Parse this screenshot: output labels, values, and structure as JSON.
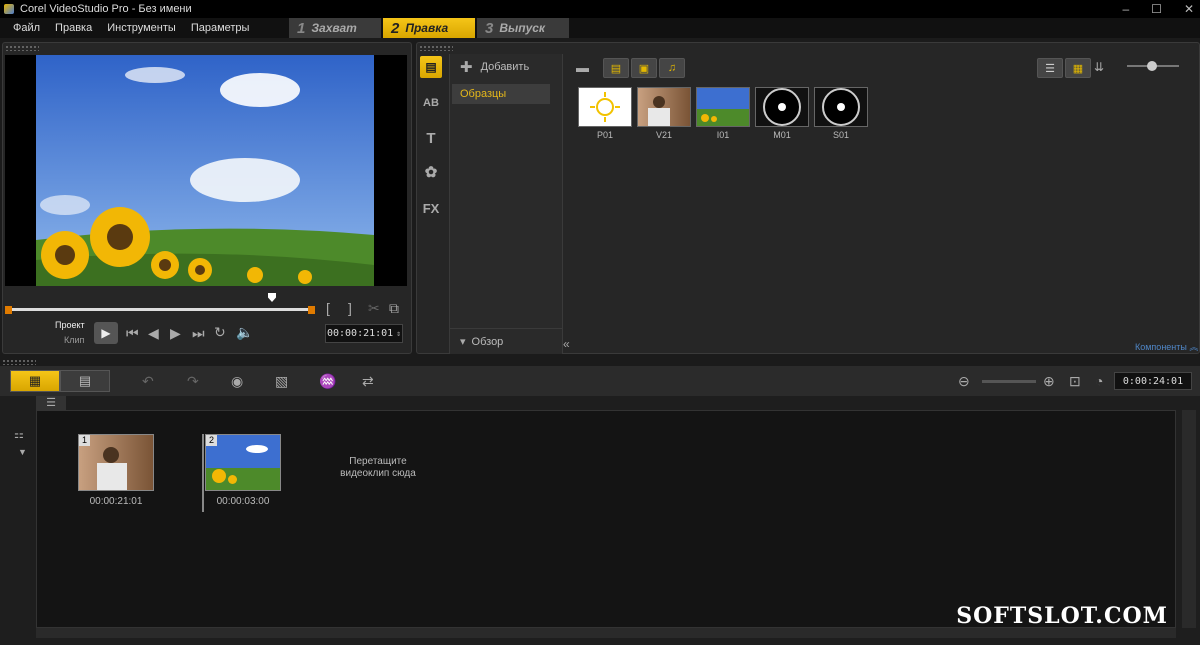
{
  "window": {
    "title": "Corel VideoStudio Pro - Без имени"
  },
  "menu": [
    "Файл",
    "Правка",
    "Инструменты",
    "Параметры"
  ],
  "steps": [
    {
      "num": "1",
      "label": "Захват"
    },
    {
      "num": "2",
      "label": "Правка"
    },
    {
      "num": "3",
      "label": "Выпуск"
    }
  ],
  "player": {
    "mode_project": "Проект",
    "mode_clip": "Клип",
    "timecode": "00:00:21:01",
    "mark_in": "[",
    "mark_out": "]"
  },
  "library": {
    "add_label": "Добавить",
    "folder_selected": "Образцы",
    "browse_label": "Обзор",
    "components_label": "Компоненты",
    "items": [
      {
        "label": "P01",
        "kind": "photo"
      },
      {
        "label": "V21",
        "kind": "video"
      },
      {
        "label": "I01",
        "kind": "image"
      },
      {
        "label": "M01",
        "kind": "audio"
      },
      {
        "label": "S01",
        "kind": "audio"
      }
    ],
    "tab_icons": [
      "media-icon",
      "transition-icon",
      "title-icon",
      "graphic-icon",
      "fx-icon"
    ],
    "tab_glyphs": [
      "▤",
      "AB",
      "T",
      "✿",
      "FX"
    ]
  },
  "timeline": {
    "project_duration": "0:00:24:01",
    "drop_hint": "Перетащите видеоклип сюда",
    "clips": [
      {
        "index": "1",
        "time": "00:00:21:01"
      },
      {
        "index": "2",
        "time": "00:00:03:00"
      }
    ]
  },
  "watermark": "SOFTSLOT.COM",
  "colors": {
    "accent": "#f5c518",
    "background": "#1b1b1b",
    "panel": "#262626"
  }
}
